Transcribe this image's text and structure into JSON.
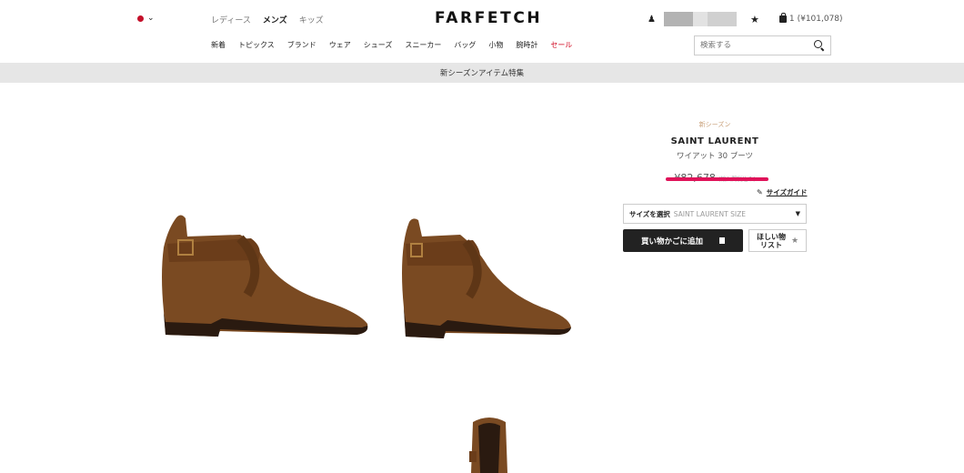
{
  "header": {
    "gender_tabs": [
      "レディース",
      "メンズ",
      "キッズ"
    ],
    "logo": "FARFETCH",
    "bag_count": "1",
    "bag_total": "(¥101,078)",
    "search_placeholder": "検索する"
  },
  "nav": [
    "新着",
    "トピックス",
    "ブランド",
    "ウェア",
    "シューズ",
    "スニーカー",
    "バッグ",
    "小物",
    "腕時計",
    "セール"
  ],
  "promo": "新シーズンアイテム特集",
  "product": {
    "tag": "新シーズン",
    "brand": "SAINT LAURENT",
    "name": "ワイアット 30 ブーツ",
    "price": "¥82,678",
    "tax_note": "(輸入関税込み)",
    "size_guide": "サイズガイド",
    "size_label": "サイズを選択",
    "size_placeholder": "SAINT LAURENT SIZE",
    "add_to_bag": "買い物かごに追加",
    "wishlist": "ほしい物\nリスト"
  },
  "colors": {
    "sale_red": "#d0021b",
    "accent_pink": "#e0135a",
    "button_dark": "#222222",
    "suede_brown": "#7a4a22"
  },
  "icons": [
    "chevron-down-icon",
    "user-icon",
    "star-icon",
    "bag-icon",
    "search-icon",
    "ruler-icon",
    "caret-down-icon"
  ]
}
